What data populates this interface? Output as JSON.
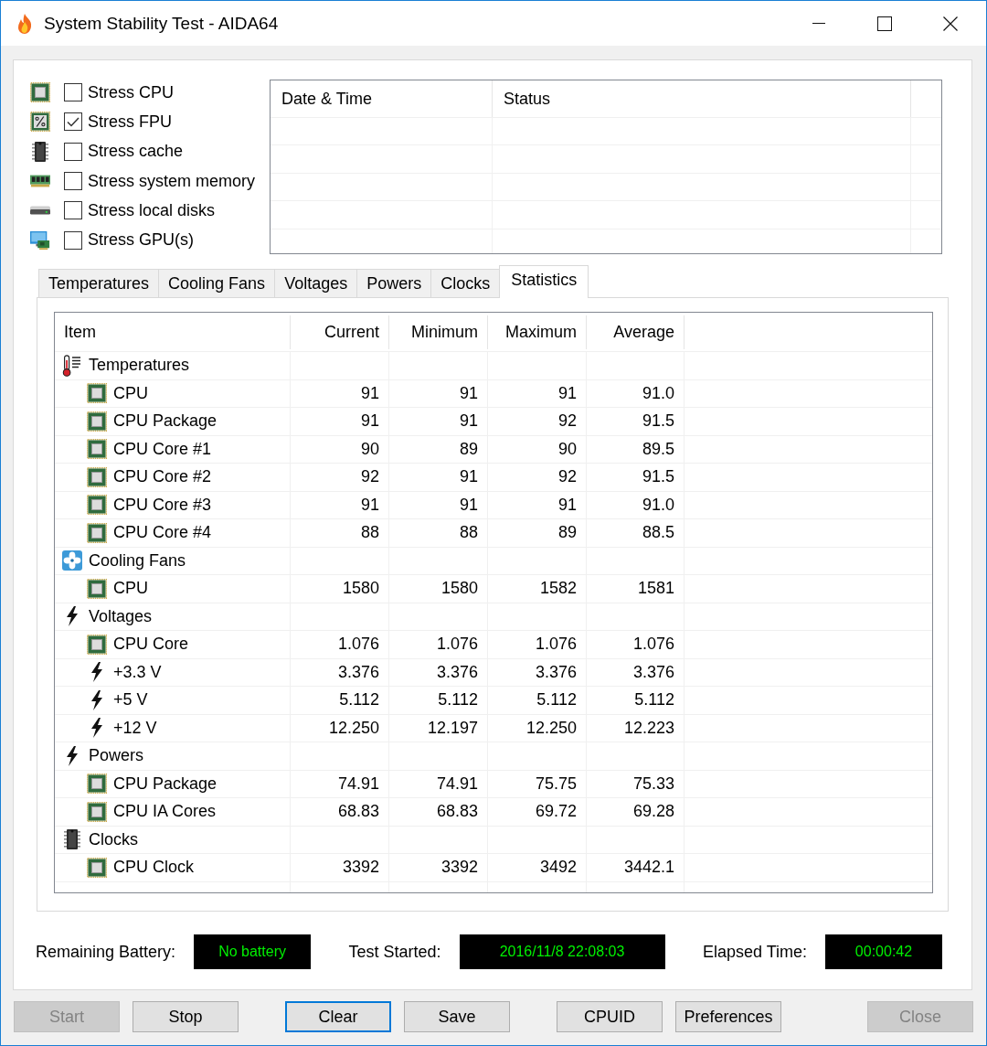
{
  "window": {
    "title": "System Stability Test - AIDA64"
  },
  "stress_options": [
    {
      "kind": "chip",
      "label": "Stress CPU",
      "checked": false
    },
    {
      "kind": "percent-chip",
      "label": "Stress FPU",
      "checked": true
    },
    {
      "kind": "ic",
      "label": "Stress cache",
      "checked": false
    },
    {
      "kind": "ram",
      "label": "Stress system memory",
      "checked": false
    },
    {
      "kind": "drive",
      "label": "Stress local disks",
      "checked": false
    },
    {
      "kind": "gpu",
      "label": "Stress GPU(s)",
      "checked": false
    }
  ],
  "log_table": {
    "columns": [
      "Date & Time",
      "Status"
    ]
  },
  "tabs": [
    {
      "label": "Temperatures",
      "selected": false
    },
    {
      "label": "Cooling Fans",
      "selected": false
    },
    {
      "label": "Voltages",
      "selected": false
    },
    {
      "label": "Powers",
      "selected": false
    },
    {
      "label": "Clocks",
      "selected": false
    },
    {
      "label": "Statistics",
      "selected": true
    }
  ],
  "statistics": {
    "columns": [
      "Item",
      "Current",
      "Minimum",
      "Maximum",
      "Average"
    ],
    "groups": [
      {
        "kind": "thermometer",
        "label": "Temperatures",
        "children": [
          {
            "kind": "chip",
            "label": "CPU",
            "values": [
              "91",
              "91",
              "91",
              "91.0"
            ]
          },
          {
            "kind": "chip",
            "label": "CPU Package",
            "values": [
              "91",
              "91",
              "92",
              "91.5"
            ]
          },
          {
            "kind": "chip",
            "label": "CPU Core #1",
            "values": [
              "90",
              "89",
              "90",
              "89.5"
            ]
          },
          {
            "kind": "chip",
            "label": "CPU Core #2",
            "values": [
              "92",
              "91",
              "92",
              "91.5"
            ]
          },
          {
            "kind": "chip",
            "label": "CPU Core #3",
            "values": [
              "91",
              "91",
              "91",
              "91.0"
            ]
          },
          {
            "kind": "chip",
            "label": "CPU Core #4",
            "values": [
              "88",
              "88",
              "89",
              "88.5"
            ]
          }
        ]
      },
      {
        "kind": "fan",
        "label": "Cooling Fans",
        "children": [
          {
            "kind": "chip",
            "label": "CPU",
            "values": [
              "1580",
              "1580",
              "1582",
              "1581"
            ]
          }
        ]
      },
      {
        "kind": "bolt",
        "label": "Voltages",
        "children": [
          {
            "kind": "chip",
            "label": "CPU Core",
            "values": [
              "1.076",
              "1.076",
              "1.076",
              "1.076"
            ]
          },
          {
            "kind": "bolt",
            "label": "+3.3 V",
            "values": [
              "3.376",
              "3.376",
              "3.376",
              "3.376"
            ]
          },
          {
            "kind": "bolt",
            "label": "+5 V",
            "values": [
              "5.112",
              "5.112",
              "5.112",
              "5.112"
            ]
          },
          {
            "kind": "bolt",
            "label": "+12 V",
            "values": [
              "12.250",
              "12.197",
              "12.250",
              "12.223"
            ]
          }
        ]
      },
      {
        "kind": "bolt",
        "label": "Powers",
        "children": [
          {
            "kind": "chip",
            "label": "CPU Package",
            "values": [
              "74.91",
              "74.91",
              "75.75",
              "75.33"
            ]
          },
          {
            "kind": "chip",
            "label": "CPU IA Cores",
            "values": [
              "68.83",
              "68.83",
              "69.72",
              "69.28"
            ]
          }
        ]
      },
      {
        "kind": "ic",
        "label": "Clocks",
        "children": [
          {
            "kind": "chip",
            "label": "CPU Clock",
            "values": [
              "3392",
              "3392",
              "3492",
              "3442.1"
            ]
          }
        ]
      }
    ]
  },
  "status_fields": [
    {
      "label": "Remaining Battery:",
      "value": "No battery"
    },
    {
      "label": "Test Started:",
      "value": "2016/11/8 22:08:03"
    },
    {
      "label": "Elapsed Time:",
      "value": "00:00:42"
    }
  ],
  "button_groups": [
    [
      {
        "label": "Start",
        "disabled": true,
        "focused": false
      },
      {
        "label": "Stop",
        "disabled": false,
        "focused": false
      }
    ],
    [
      {
        "label": "Clear",
        "disabled": false,
        "focused": true
      },
      {
        "label": "Save",
        "disabled": false,
        "focused": false
      }
    ],
    [
      {
        "label": "CPUID",
        "disabled": false,
        "focused": false
      },
      {
        "label": "Preferences",
        "disabled": false,
        "focused": false
      }
    ],
    [
      {
        "label": "Close",
        "disabled": true,
        "focused": false
      }
    ]
  ]
}
